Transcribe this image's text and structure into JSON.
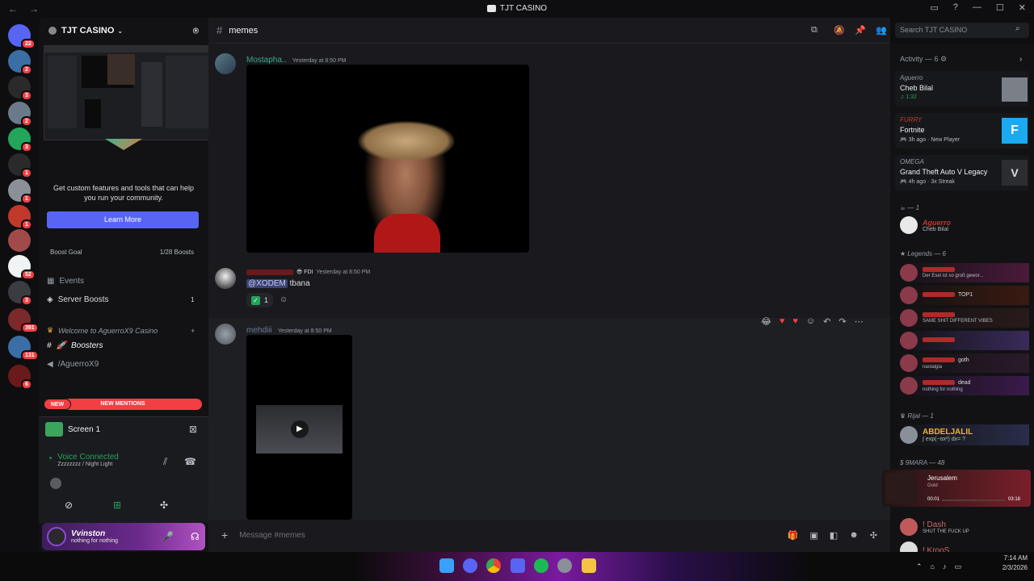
{
  "window": {
    "title": "TJT CASINO"
  },
  "guilds": [
    {
      "badge": "22"
    },
    {
      "badge": "2"
    },
    {
      "badge": "3"
    },
    {
      "badge": "2"
    },
    {
      "badge": "3"
    },
    {
      "badge": "1"
    },
    {
      "badge": "1"
    },
    {
      "badge": "1"
    },
    {
      "badge": ""
    },
    {
      "badge": "52"
    },
    {
      "badge": "3"
    },
    {
      "badge": "391"
    },
    {
      "badge": "131"
    },
    {
      "badge": "6"
    }
  ],
  "server": {
    "name": "TJT CASINO",
    "promo_text": "Get custom features and tools that can help you run your community.",
    "learn_more": "Learn More",
    "boost_goal": "Boost Goal",
    "boost_count": "1/28 Boosts",
    "events": "Events",
    "server_boosts": "Server Boosts",
    "server_boosts_count": "1",
    "category": "Welcome to AguerroX9 Casino",
    "channel_boosters": "Boosters",
    "channel_voice": "/AguerroX9",
    "new_tag": "NEW",
    "new_mentions": "NEW MENTIONS"
  },
  "voice": {
    "screen": "Screen 1",
    "status": "Voice Connected",
    "detail": "Zzzzzzzz / Night Light"
  },
  "user": {
    "name": "Vvinston",
    "status": "nothing for nothing"
  },
  "channel": {
    "name": "memes",
    "search_placeholder": "Search TJT CASINO",
    "composer_placeholder": "Message #memes"
  },
  "messages": [
    {
      "author": "Mostapha..",
      "time": "Yesterday at 8:50 PM"
    },
    {
      "author": "",
      "tag": "FDI",
      "time": "Yesterday at 8:50 PM",
      "mention": "@XODEM",
      "text": "tbana",
      "reaction_count": "1"
    },
    {
      "author": "mehdiii",
      "time": "Yesterday at 8:50 PM"
    }
  ],
  "members": {
    "activity_header": "Activity — 6",
    "activities": [
      {
        "user": "Aguerro",
        "title": "Cheb Bilal",
        "sub": "1:32"
      },
      {
        "user": "FURRY",
        "title": "Fortnite",
        "sub": "3h ago",
        "sub2": "New Player"
      },
      {
        "user": "OMEGA",
        "title": "Grand Theft Auto V Legacy",
        "sub": "4h ago",
        "sub2": "3x Streak"
      }
    ],
    "group1": "— 1",
    "aguerro": {
      "name": "Aguerro",
      "status": "Cheb Bilal"
    },
    "legends_header": "Legends — 6",
    "legends": [
      {
        "name": "",
        "status": "Der Esel ist so groß gewor..."
      },
      {
        "name": "",
        "tag": "TOP1",
        "status": ""
      },
      {
        "name": "",
        "status": "SAME SHIT DIFFERENT VIBES"
      },
      {
        "name": "",
        "status": ""
      },
      {
        "name": "",
        "tag": "goth",
        "status": "nastalgia"
      },
      {
        "name": "",
        "tag": "dead",
        "status": "nothing for nothing"
      }
    ],
    "rijal_header": "Rijal — 1",
    "rijal": {
      "name": "ABDELJALIL",
      "status": "∫ exp(−αx²) dx= ?"
    },
    "mara_header": "9MARA — 48",
    "music": {
      "title": "Jerusalem",
      "artist": "Gold",
      "start": "00:01",
      "end": "03:18"
    },
    "dash": {
      "name": "! Dash",
      "status": "SHUT THE FUCK UP"
    },
    "kroos": {
      "name": "! KrooS"
    }
  },
  "taskbar": {
    "time": "7:14 AM",
    "date": "2/3/2026"
  },
  "colors": {
    "accent": "#5865f2",
    "mention_red": "#f23f43",
    "online": "#23a55a"
  }
}
